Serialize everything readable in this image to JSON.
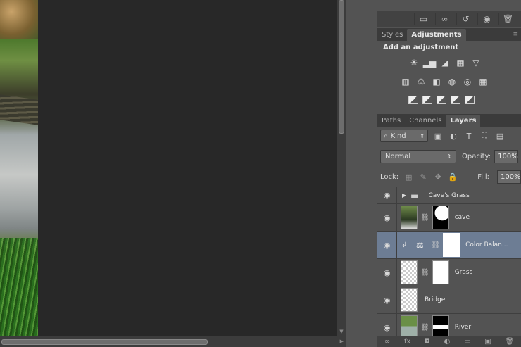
{
  "top_toolbar": {
    "icons": [
      "new-state-icon",
      "link-icon",
      "undo-icon",
      "eye-icon",
      "trash-icon"
    ]
  },
  "adjust_tabs": [
    {
      "label": "Styles",
      "active": false
    },
    {
      "label": "Adjustments",
      "active": true
    }
  ],
  "adjustments": {
    "title": "Add an adjustment",
    "row1": [
      "☀",
      "▂▅",
      "◢",
      "▦",
      "▽"
    ],
    "row2": [
      "▥",
      "⚖",
      "◧",
      "◍",
      "◎",
      "▦"
    ],
    "row3": [
      "◩",
      "◪",
      "◪",
      "◩",
      "◫"
    ]
  },
  "layer_tabs": [
    {
      "label": "Paths",
      "active": false
    },
    {
      "label": "Channels",
      "active": false
    },
    {
      "label": "Layers",
      "active": true
    }
  ],
  "filter": {
    "kind_label": "Kind",
    "icons": [
      "▣",
      "◐",
      "T",
      "⛶",
      "▤"
    ]
  },
  "blend": {
    "mode": "Normal",
    "opacity_label": "Opacity:",
    "opacity": "100%"
  },
  "lock": {
    "label": "Lock:",
    "fill_label": "Fill:",
    "fill": "100%"
  },
  "layers": [
    {
      "name": "Cave's Grass",
      "type": "group"
    },
    {
      "name": "cave",
      "type": "pixel"
    },
    {
      "name": "Color Balan...",
      "type": "adjustment",
      "selected": true
    },
    {
      "name": "Grass",
      "type": "pixel"
    },
    {
      "name": "Bridge",
      "type": "pixel"
    },
    {
      "name": "River",
      "type": "pixel"
    }
  ],
  "bottom_icons": [
    "GO",
    "fx",
    "◘",
    "◐",
    "▭",
    "▣",
    "🗑"
  ],
  "colors": {
    "panel": "#535353",
    "canvas": "#282828",
    "selection": "#6d7d94"
  }
}
